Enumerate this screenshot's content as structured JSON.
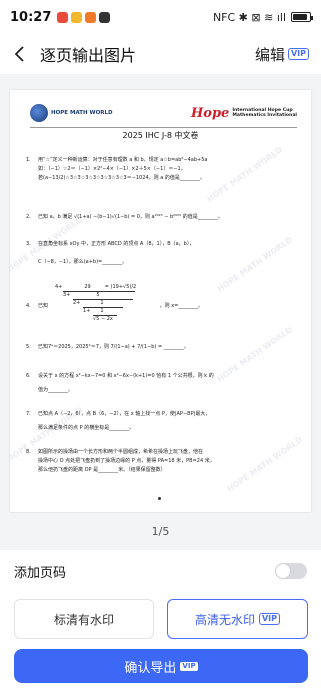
{
  "status_bar": {
    "time": "10:27",
    "right_text": "NFC ✱ ⊠ ≋ ıll",
    "battery_level": 0.85
  },
  "header": {
    "title": "逐页输出图片",
    "edit_label": "编辑",
    "edit_badge": "VIP"
  },
  "document": {
    "logo_left": "HOPE MATH WORLD",
    "logo_right_mark": "Hope",
    "logo_right_line1": "International Hope Cup",
    "logo_right_line2": "Mathematics Invitational",
    "title": "2025 IHC J-8  中文卷",
    "watermark_text": "HOPE MATH WORLD",
    "questions": [
      {
        "num": "1.",
        "lines": [
          "用“☆”定义一种新运算：对于任意有理数 a 和 b，规定 a☆b=ab²−4ab+5a",
          "如：（−1）☆2＝（−1）×2²−4×（−1）×2＋5×（−1）＝−1。",
          "若(a−13/2)☆3☆3☆3☆3☆3☆3☆3☆3＝−1024，则 a 的值是________。"
        ]
      },
      {
        "num": "2.",
        "lines": [
          "已知 a，b 满足 √(1+a) −(b−1)√(1−b) = 0，则 a²⁰²⁵ − b²⁰²⁵ 的值是________。"
        ]
      },
      {
        "num": "3.",
        "lines": [
          "在直角坐标系 xOy 中，正方形 ABCD 的顶点 A（8，1），B（a，b），",
          "C（−8，−1），那么(a+b)=________。"
        ]
      },
      {
        "num": "4.",
        "lines": [
          "已知",
          "，则 x=________。"
        ]
      },
      {
        "num": "5.",
        "lines": [
          "已知7ᵃ＝2025，2025ᵇ＝7，则 7/(1−a) + 7/(1−b) = ________。"
        ]
      },
      {
        "num": "6.",
        "lines": [
          "设关于 x 的方程 x²−kx−7=0 和 x²−6x−(k+1)=0 恰有 1 个公共根，则 k 的",
          "值为________。"
        ]
      },
      {
        "num": "7.",
        "lines": [
          "已知点 A（−2，6），点 B（6，−2），在 x 轴上找一点 P，使|AP−BP|最大，",
          "那么满足条件的点 P 的横坐标是________。"
        ]
      },
      {
        "num": "8.",
        "lines": [
          "如图所示的操场由一个长方形和两个半圆组成，希希在操场上玩飞盘，他在",
          "操场中心 O 点处把飞盘扔到了操场边缘的 P 点，量得 PA=18 米，PB=24 米，",
          "那么他扔飞盘的距离 OP 是________米。（结果保留整数）"
        ]
      }
    ],
    "q4_nested": [
      "4+",
      "29",
      "3+",
      "5",
      "2+",
      "1",
      "1+",
      "1",
      "√5 − 2x",
      "= (19+√5)/2"
    ]
  },
  "page_counter": "1/5",
  "options": {
    "page_number_label": "添加页码",
    "page_number_enabled": false,
    "sd_label": "标清有水印",
    "hd_label": "高清无水印",
    "hd_badge": "VIP",
    "confirm_label": "确认导出",
    "confirm_badge": "VIP"
  },
  "colors": {
    "accent": "#3d68f5",
    "hope_red": "#c8202a"
  }
}
